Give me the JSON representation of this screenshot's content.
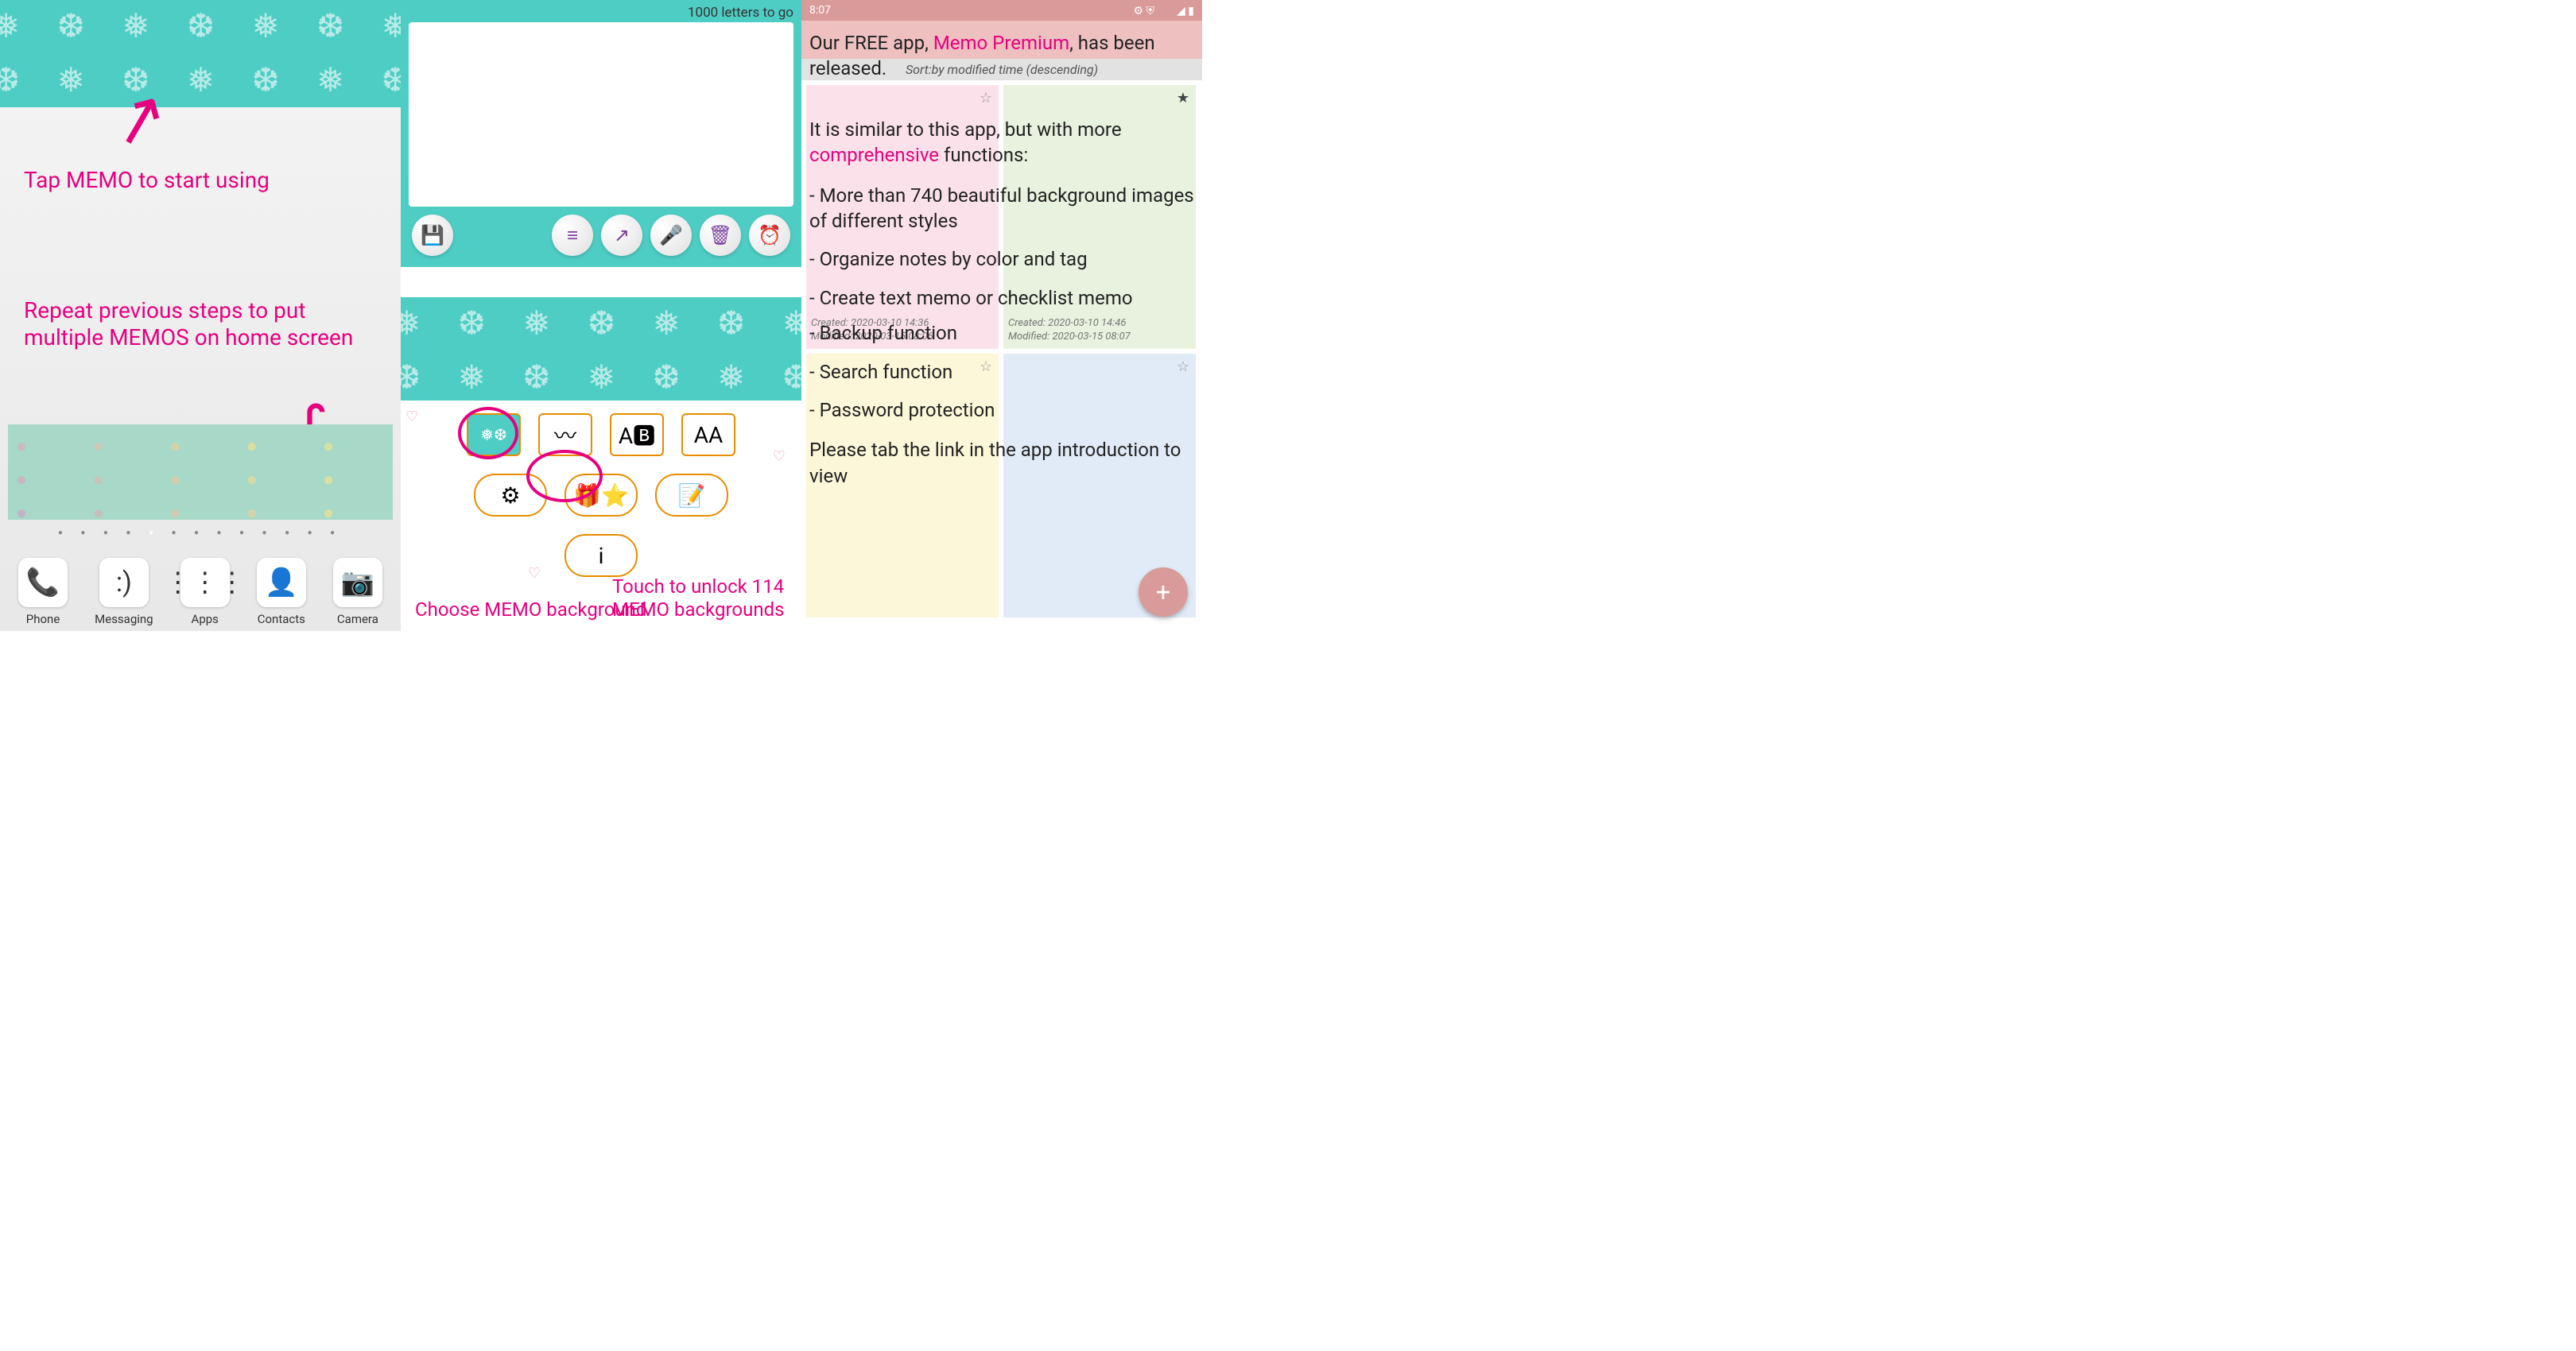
{
  "panel1": {
    "annotation_tap": "Tap MEMO to start using",
    "annotation_repeat": "Repeat previous steps to put multiple MEMOS on home screen",
    "dock": [
      {
        "label": "Phone",
        "icon": "📞"
      },
      {
        "label": "Messaging",
        "icon": ":)"
      },
      {
        "label": "Apps",
        "icon": "⋮⋮⋮"
      },
      {
        "label": "Contacts",
        "icon": "👤"
      },
      {
        "label": "Camera",
        "icon": "📷"
      }
    ]
  },
  "panel2": {
    "counter": "1000 letters to go",
    "buttons": {
      "save": "💾",
      "align": "≡",
      "share": "↗",
      "mic": "🎤",
      "trash": "🗑",
      "alarm": "⏰"
    },
    "opts": {
      "bg": "❅❆",
      "wave": "〰",
      "ab": "A🅱",
      "aa": "AA",
      "gear": "⚙",
      "stars": "🎁⭐",
      "memo": "📝",
      "info": "i"
    },
    "annotation_choose": "Choose MEMO background",
    "annotation_unlock": "Touch to unlock 114 MEMO backgrounds"
  },
  "panel3": {
    "status_time": "8:07",
    "sort_label": "Sort:by modified time (descending)",
    "cards": [
      {
        "created": "Created: 2020-03-10  14:36",
        "modified": "Modified: 2020-03-15  08:06",
        "star": "☆"
      },
      {
        "created": "Created: 2020-03-10  14:46",
        "modified": "Modified: 2020-03-15  08:07",
        "star": "★"
      },
      {
        "star": "☆"
      },
      {
        "star": "☆"
      }
    ],
    "overlay": {
      "l1a": "Our FREE app, ",
      "l1b": "Memo Premium",
      "l1c": ", has been released.",
      "l2a": "It is similar to this app, but with more ",
      "l2b": "comprehensive",
      "l2c": " functions:",
      "f1": "- More than 740 beautiful background images of different styles",
      "f2": "- Organize notes by color and tag",
      "f3": "- Create text memo or checklist memo",
      "f4": "- Backup function",
      "f5": "- Search function",
      "f6": "- Password protection",
      "tail": "Please tab the link in the app introduction to view"
    },
    "fab": "+"
  }
}
